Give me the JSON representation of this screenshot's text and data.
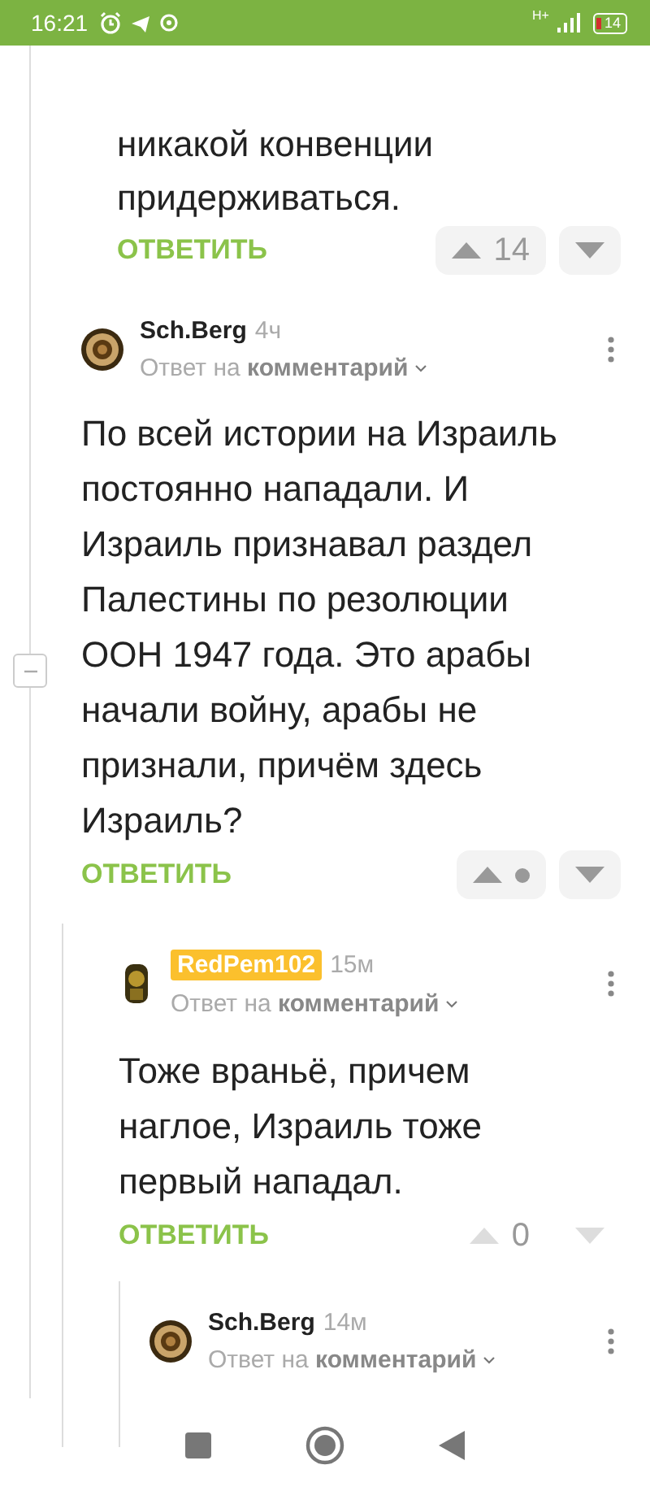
{
  "status_bar": {
    "time": "16:21",
    "network": "H+",
    "battery": "14"
  },
  "previous_comment": {
    "text": "никакой конвенции придерживаться.",
    "reply": "ОТВЕТИТЬ",
    "vote": {
      "kind": "count",
      "score": "14",
      "highlighted": true
    }
  },
  "thread": {
    "author": "Sch.Berg",
    "op": false,
    "time": "4ч",
    "reply_to": "Ответ на **комментарий**",
    "expanded": true,
    "text": "По всей истории на Израиль постоянно нападали. И Израиль признавал раздел Палестины по резолюции ООН 1947 года. Это арабы начали войну, арабы не признали, причём здесь Израиль?",
    "reply": "ОТВЕТИТЬ",
    "vote": {
      "kind": "hidden",
      "highlighted": true
    },
    "children": [
      {
        "author": "RedPem102",
        "op": true,
        "time": "15м",
        "reply_to": "Ответ на **комментарий**",
        "text": "Тоже враньё, причем наглое, Израиль тоже первый нападал.",
        "reply": "ОТВЕТИТЬ",
        "vote": {
          "kind": "count",
          "score": "0",
          "highlighted": false
        },
        "children": [
          {
            "author": "Sch.Berg",
            "op": false,
            "time": "14м",
            "reply_to": "Ответ на **комментарий**"
          }
        ]
      }
    ]
  }
}
